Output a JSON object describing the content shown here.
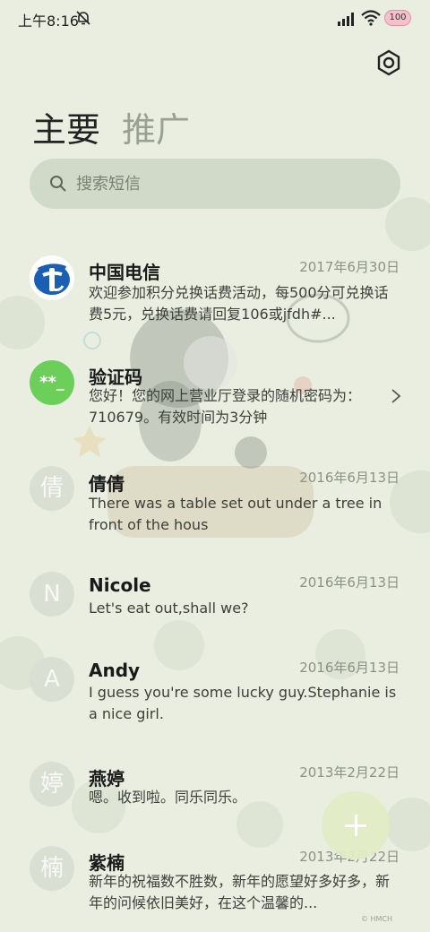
{
  "status_bar": {
    "time": "上午8:16",
    "battery": "100"
  },
  "tabs": [
    {
      "label": "主要",
      "active": true
    },
    {
      "label": "推广",
      "active": false
    }
  ],
  "search": {
    "placeholder": "搜索短信"
  },
  "messages": [
    {
      "sender": "中国电信",
      "date": "2017年6月30日",
      "preview": "欢迎参加积分兑换话费活动，每500分可兑换话费5元，兑换话费请回复106或jfdh#...",
      "avatar_type": "telecom-logo"
    },
    {
      "sender": "验证码",
      "date": "",
      "preview": "您好！您的网上营业厅登录的随机密码为：710679。有效时间为3分钟",
      "avatar_type": "code-badge",
      "avatar_text": "**_"
    },
    {
      "sender": "倩倩",
      "date": "2016年6月13日",
      "preview": "There was a table set out under a tree in front of the hous",
      "avatar_letter": "倩"
    },
    {
      "sender": "Nicole",
      "date": "2016年6月13日",
      "preview": "Let's eat out,shall we?",
      "avatar_letter": "N"
    },
    {
      "sender": "Andy",
      "date": "2016年6月13日",
      "preview": "I guess you're some lucky guy.Stephanie is a nice girl.",
      "avatar_letter": "A"
    },
    {
      "sender": "燕婷",
      "date": "2013年2月22日",
      "preview": "嗯。收到啦。同乐同乐。",
      "avatar_letter": "婷"
    },
    {
      "sender": "紫楠",
      "date": "2013年2月22日",
      "preview": "新年的祝福数不胜数，新年的愿望好多好多，新年的问候依旧美好，在这个温馨的...",
      "avatar_letter": "楠"
    }
  ],
  "watermark": "© HMCH",
  "colors": {
    "background": "#e9eee0",
    "code_badge": "#6ccf5a",
    "telecom_blue": "#1b5fb5"
  }
}
